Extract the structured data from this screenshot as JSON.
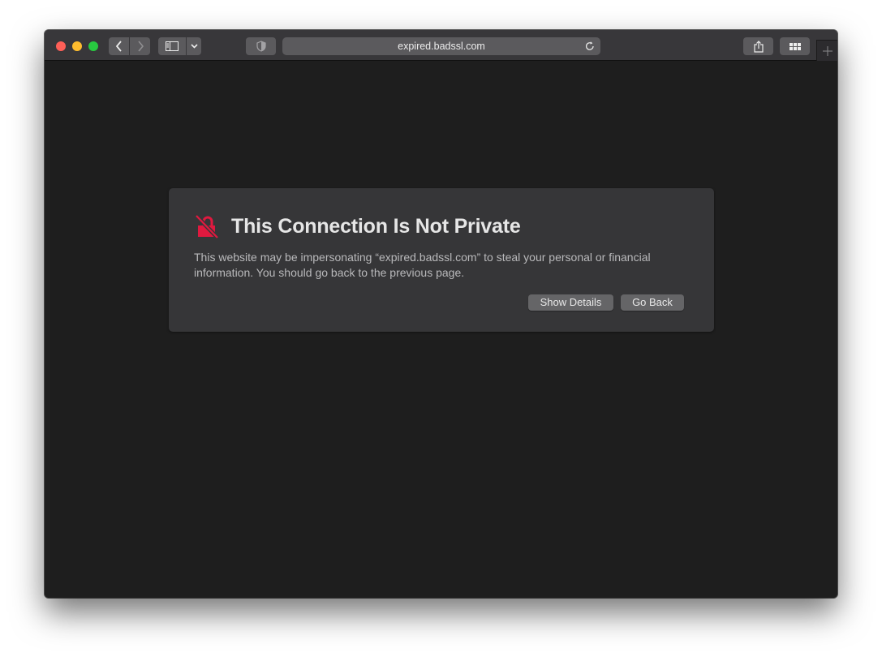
{
  "browser": {
    "address_bar": {
      "url": "expired.badssl.com"
    },
    "toolbar": {
      "back_icon": "chevron-left-icon",
      "forward_icon": "chevron-right-icon",
      "sidebar_icon": "sidebar-icon",
      "sidebar_dropdown_icon": "chevron-down-icon",
      "privacy_icon": "shield-icon",
      "reload_icon": "reload-icon",
      "share_icon": "share-icon",
      "tab_overview_icon": "grid-icon",
      "new_tab_icon": "plus-icon"
    }
  },
  "warning": {
    "icon": "broken-lock-icon",
    "title": "This Connection Is Not Private",
    "message": "This website may be impersonating “expired.badssl.com” to steal your personal or financial information. You should go back to the previous page.",
    "buttons": {
      "show_details": "Show Details",
      "go_back": "Go Back"
    },
    "accent_color": "#e0193f"
  }
}
